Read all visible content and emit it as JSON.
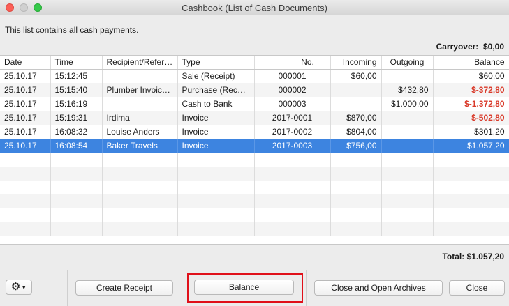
{
  "window": {
    "title": "Cashbook (List of Cash Documents)"
  },
  "intro_text": "This list contains all cash payments.",
  "carryover": {
    "label": "Carryover:",
    "value": "$0,00"
  },
  "table": {
    "columns": [
      "Date",
      "Time",
      "Recipient/Refere...",
      "Type",
      "No.",
      "Incoming",
      "Outgoing",
      "Balance"
    ],
    "rows": [
      {
        "date": "25.10.17",
        "time": "15:12:45",
        "recipient": "",
        "type": "Sale (Receipt)",
        "no": "000001",
        "incoming": "$60,00",
        "outgoing": "",
        "balance": "$60,00",
        "negative": false,
        "selected": false
      },
      {
        "date": "25.10.17",
        "time": "15:15:40",
        "recipient": "Plumber Invoice ...",
        "type": "Purchase (Record...",
        "no": "000002",
        "incoming": "",
        "outgoing": "$432,80",
        "balance": "$-372,80",
        "negative": true,
        "selected": false
      },
      {
        "date": "25.10.17",
        "time": "15:16:19",
        "recipient": "",
        "type": "Cash to Bank",
        "no": "000003",
        "incoming": "",
        "outgoing": "$1.000,00",
        "balance": "$-1.372,80",
        "negative": true,
        "selected": false
      },
      {
        "date": "25.10.17",
        "time": "15:19:31",
        "recipient": "Irdima",
        "type": "Invoice",
        "no": "2017-0001",
        "incoming": "$870,00",
        "outgoing": "",
        "balance": "$-502,80",
        "negative": true,
        "selected": false
      },
      {
        "date": "25.10.17",
        "time": "16:08:32",
        "recipient": "Louise Anders",
        "type": "Invoice",
        "no": "2017-0002",
        "incoming": "$804,00",
        "outgoing": "",
        "balance": "$301,20",
        "negative": false,
        "selected": false
      },
      {
        "date": "25.10.17",
        "time": "16:08:54",
        "recipient": "Baker Travels",
        "type": "Invoice",
        "no": "2017-0003",
        "incoming": "$756,00",
        "outgoing": "",
        "balance": "$1.057,20",
        "negative": false,
        "selected": true
      }
    ]
  },
  "total": {
    "label": "Total:",
    "value": "$1.057,20"
  },
  "buttons": {
    "gear_icon": "gear-icon",
    "create_receipt": "Create Receipt",
    "balance": "Balance",
    "close_archives": "Close and Open Archives",
    "close": "Close"
  },
  "colors": {
    "selection": "#3d84e0",
    "negative": "#d93a2a",
    "highlight": "#e0101a"
  }
}
